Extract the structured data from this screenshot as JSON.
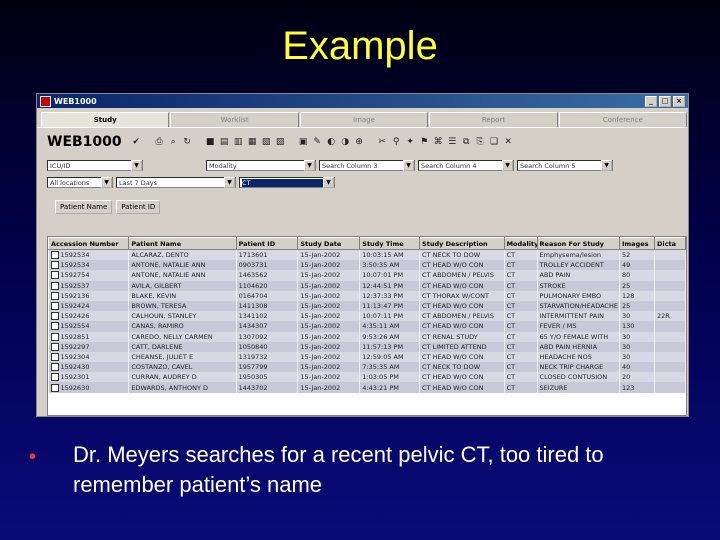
{
  "slide": {
    "title": "Example",
    "bullet": "•",
    "text": "Dr. Meyers searches for a recent pelvic CT, too tired to remember patient’s name"
  },
  "window": {
    "title": "WEB1000",
    "controls": [
      "_",
      "□",
      "×"
    ]
  },
  "tabs": [
    {
      "label": "Study",
      "active": true
    },
    {
      "label": "Worklist",
      "active": false
    },
    {
      "label": "Image",
      "active": false
    },
    {
      "label": "Report",
      "active": false
    },
    {
      "label": "Conference",
      "active": false
    }
  ],
  "toolbar": {
    "logo": "WEB1000",
    "icons": [
      "check-icon",
      "print-icon",
      "find-icon",
      "refresh-icon",
      "layout1-icon",
      "layout2-icon",
      "layout3-icon",
      "layout4-icon",
      "layout5-icon",
      "layout6-icon",
      "monitor-icon",
      "tool1-icon",
      "tool2-icon",
      "tool3-icon",
      "tool4-icon",
      "tool5-icon",
      "tool6-icon",
      "tool7-icon",
      "tool8-icon",
      "tool9-icon",
      "tool10-icon",
      "tool11-icon",
      "tool12-icon",
      "books-icon",
      "close-icon"
    ]
  },
  "filters": {
    "row1": [
      "ICU/ID",
      "Modality",
      "Search Column 3",
      "Search Column 4",
      "Search Column 5"
    ],
    "row2": [
      "All locations",
      "Last 7 Days",
      "CT"
    ]
  },
  "buttons": {
    "patient_name": "Patient Name",
    "patient_id": "Patient ID"
  },
  "table": {
    "columns": [
      "Accession Number",
      "Patient Name",
      "Patient ID",
      "Study Date",
      "Study Time",
      "Study Description",
      "Modality",
      "Reason For Study",
      "Images",
      "Dicta"
    ],
    "rows": [
      [
        "1592534",
        "ALCARAZ, DENTO",
        "1713601",
        "15-Jan-2002",
        "10:03:15 AM",
        "CT NECK TO DOW",
        "CT",
        "Emphysema/lesion",
        "52",
        ""
      ],
      [
        "1592534",
        "ANTONE, NATALIE ANN",
        "0903731",
        "15-Jan-2002",
        "3:50:35 AM",
        "CT HEAD W/O CON",
        "CT",
        "TROLLEY ACCIDENT",
        "49",
        ""
      ],
      [
        "1592754",
        "ANTONE, NATALIE ANN",
        "1463562",
        "15-Jan-2002",
        "10:07:01 PM",
        "CT ABDOMEN / PELVIS",
        "CT",
        "ABD PAIN",
        "80",
        ""
      ],
      [
        "1592537",
        "AVILA, GILBERT",
        "1104620",
        "15-Jan-2002",
        "12:44:51 PM",
        "CT HEAD W/O CON",
        "CT",
        "STROKE",
        "25",
        ""
      ],
      [
        "1592136",
        "BLAKE, KEVIN",
        "0164704",
        "15-Jan-2002",
        "12:37:33 PM",
        "CT THORAX W/CONT",
        "CT",
        "PULMONARY EMBO",
        "128",
        ""
      ],
      [
        "1592424",
        "BROWN, TERESA",
        "1411308",
        "15-Jan-2002",
        "11:13:47 PM",
        "CT HEAD W/O CON",
        "CT",
        "STARVATION/HEADACHE",
        "25",
        ""
      ],
      [
        "1592426",
        "CALHOUN, STANLEY",
        "1341102",
        "15-Jan-2002",
        "10:07:11 PM",
        "CT ABDOMEN / PELVIS",
        "CT",
        "INTERMITTENT PAIN",
        "30",
        "22R"
      ],
      [
        "1592554",
        "CANAS, RAMIRO",
        "1434307",
        "15-Jan-2002",
        "4:35:11 AM",
        "CT HEAD W/O CON",
        "CT",
        "FEVER / MS",
        "130",
        ""
      ],
      [
        "1592851",
        "CAREDO, NELLY CARMEN",
        "1307092",
        "15-Jan-2002",
        "9:53:26 AM",
        "CT RENAL STUDY",
        "CT",
        "65 Y/O FEMALE WITH",
        "30",
        ""
      ],
      [
        "1592297",
        "CATT, DARLENE",
        "1050840",
        "15-Jan-2002",
        "11:57:13 PM",
        "CT LIMITED ATTEND",
        "CT",
        "ABD PAIN HERNIA",
        "30",
        ""
      ],
      [
        "1592304",
        "CHEANSE, JULIET E",
        "1319732",
        "15-Jan-2002",
        "12:59:05 AM",
        "CT HEAD W/O CON",
        "CT",
        "HEADACHE NOS",
        "30",
        ""
      ],
      [
        "1592430",
        "COSTANZO, CAVEL",
        "1957799",
        "15-Jan-2002",
        "7:35:35 AM",
        "CT NECK TO DOW",
        "CT",
        "NECK TRIP CHARGE",
        "40",
        ""
      ],
      [
        "1592301",
        "CURRAN, AUDREY D",
        "1950305",
        "15-Jan-2002",
        "1:03:05 PM",
        "CT HEAD W/O CON",
        "CT",
        "CLOSED CONTUSION",
        "20",
        ""
      ],
      [
        "1592630",
        "EDWARDS, ANTHONY D",
        "1443702",
        "15-Jan-2002",
        "4:43:21 PM",
        "CT HEAD W/O CON",
        "CT",
        "SEIZURE",
        "123",
        ""
      ]
    ]
  }
}
